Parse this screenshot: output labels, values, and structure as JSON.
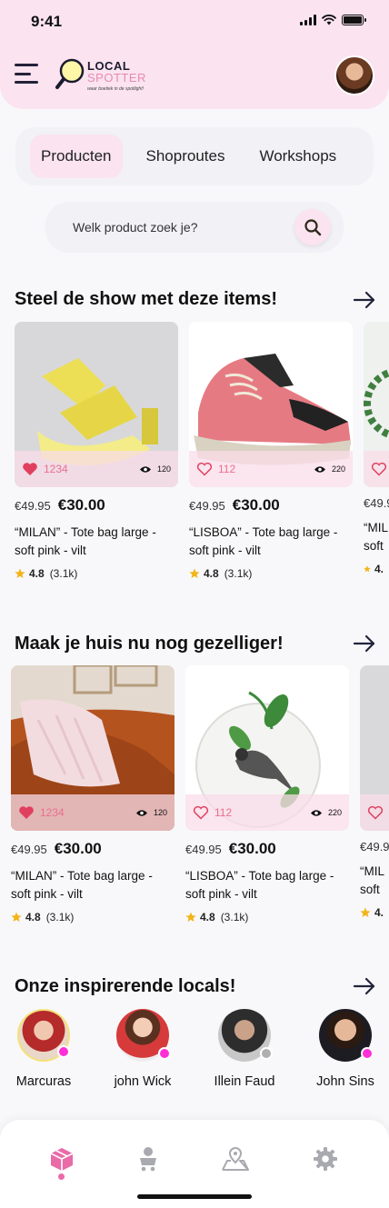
{
  "status_bar": {
    "time": "9:41"
  },
  "header": {
    "logo_local": "LOCAL",
    "logo_spotter": "SPOTTER",
    "logo_tagline": "waar boetiek in de spotlight!"
  },
  "tabs": [
    {
      "label": "Producten",
      "active": true
    },
    {
      "label": "Shoproutes",
      "active": false
    },
    {
      "label": "Workshops",
      "active": false
    }
  ],
  "search": {
    "placeholder": "Welk product zoek je?"
  },
  "sections": [
    {
      "title": "Steel de show met deze items!",
      "cards": [
        {
          "likes": "1234",
          "liked": true,
          "views": "120",
          "old_price": "€49.95",
          "price": "€30.00",
          "name": "“MILAN” - Tote bag large - soft pink - vilt",
          "rating": "4.8",
          "reviews": "(3.1k)"
        },
        {
          "likes": "112",
          "liked": false,
          "views": "220",
          "old_price": "€49.95",
          "price": "€30.00",
          "name": "“LISBOA” - Tote bag large - soft pink - vilt",
          "rating": "4.8",
          "reviews": "(3.1k)"
        },
        {
          "likes": "",
          "liked": false,
          "views": "",
          "old_price": "€49.9",
          "price": "",
          "name": "“MIL soft",
          "rating": "4.",
          "reviews": ""
        }
      ]
    },
    {
      "title": "Maak je huis nu nog gezelliger!",
      "cards": [
        {
          "likes": "1234",
          "liked": true,
          "views": "120",
          "old_price": "€49.95",
          "price": "€30.00",
          "name": "“MILAN” - Tote bag large - soft pink - vilt",
          "rating": "4.8",
          "reviews": "(3.1k)"
        },
        {
          "likes": "112",
          "liked": false,
          "views": "220",
          "old_price": "€49.95",
          "price": "€30.00",
          "name": "“LISBOA” - Tote bag large - soft pink - vilt",
          "rating": "4.8",
          "reviews": "(3.1k)"
        },
        {
          "likes": "",
          "liked": false,
          "views": "",
          "old_price": "€49.9",
          "price": "",
          "name": "“MIL soft",
          "rating": "4.",
          "reviews": ""
        }
      ]
    }
  ],
  "locals_section": {
    "title": "Onze inspirerende locals!",
    "locals": [
      {
        "name": "Marcuras",
        "status": "online"
      },
      {
        "name": "john Wick",
        "status": "online"
      },
      {
        "name": "Illein Faud",
        "status": "offline"
      },
      {
        "name": "John Sins",
        "status": "online"
      }
    ]
  },
  "bottom_nav": [
    {
      "icon": "package-icon",
      "active": true
    },
    {
      "icon": "person-cart-icon",
      "active": false
    },
    {
      "icon": "map-pin-icon",
      "active": false
    },
    {
      "icon": "gear-icon",
      "active": false
    }
  ],
  "colors": {
    "brand_pink": "#fbe3ef",
    "accent_pink": "#e96ba8",
    "heart_red": "#e0405e",
    "online_dot": "#ff2fd7",
    "offline_dot": "#b0b0b0",
    "star": "#f2b418"
  }
}
